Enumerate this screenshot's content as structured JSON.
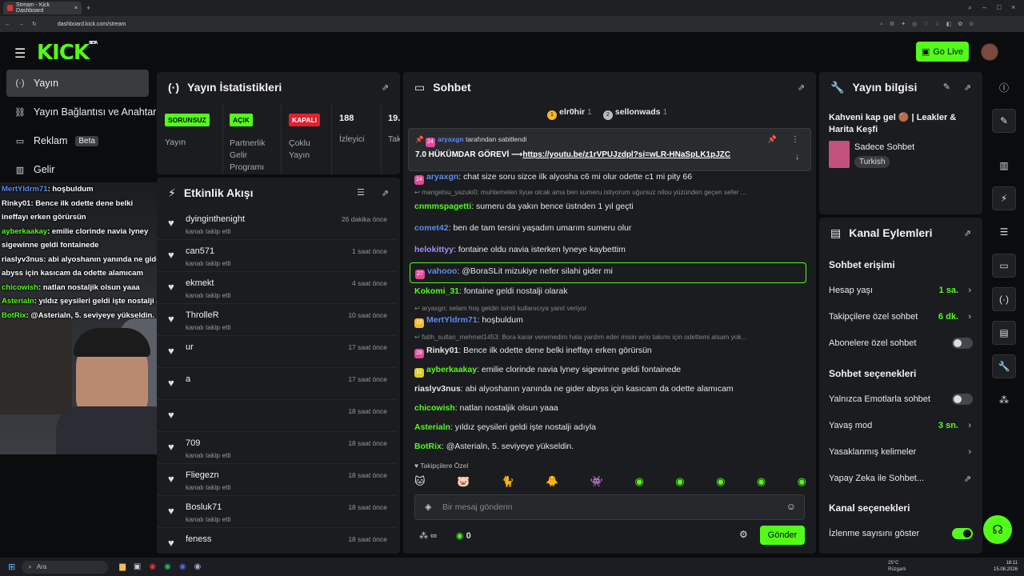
{
  "browser": {
    "tab_title": "Stream - Kick Dashboard",
    "url": "dashboard.kick.com/stream"
  },
  "header": {
    "logo": "KICK",
    "logo_badge": "BETA",
    "go_live": "Go Live"
  },
  "nav": [
    {
      "label": "Yayın",
      "icon": "(·)"
    },
    {
      "label": "Yayın Bağlantısı ve Anahtar",
      "icon": "⛓"
    },
    {
      "label": "Reklam",
      "icon": "▭",
      "badge": "Beta"
    },
    {
      "label": "Gelir",
      "icon": "▥"
    }
  ],
  "stats": {
    "title": "Yayın İstatistikleri",
    "items": [
      {
        "badge": "SORUNSUZ",
        "label": "Yayın",
        "color": "#53fc18"
      },
      {
        "badge": "AÇIK",
        "label": "Partnerlik Gelir Programı",
        "color": "#53fc18"
      },
      {
        "badge": "KAPALI",
        "label": "Çoklu Yayın",
        "color": "#e0222f"
      },
      {
        "value": "188",
        "label": "İzleyici"
      },
      {
        "value": "19.",
        "label": "Tak"
      }
    ]
  },
  "activity": {
    "title": "Etkinlik Akışı",
    "items": [
      {
        "name": "dyinginthenight",
        "sub": "kanalı takip etti",
        "time": "26 dakika önce"
      },
      {
        "name": "can571",
        "sub": "kanalı takip etti",
        "time": "1 saat önce"
      },
      {
        "name": "ekmekt",
        "sub": "kanalı takip etti",
        "time": "4 saat önce"
      },
      {
        "name": "ThrolleR",
        "sub": "kanalı takip etti",
        "time": "10 saat önce"
      },
      {
        "name": "ur",
        "sub": "",
        "time": "17 saat önce"
      },
      {
        "name": "a",
        "sub": "",
        "time": "17 saat önce"
      },
      {
        "name": "",
        "sub": "",
        "time": "18 saat önce"
      },
      {
        "name": "709",
        "sub": "kanalı takip etti",
        "time": "18 saat önce"
      },
      {
        "name": "Fliegezn",
        "sub": "kanalı takip etti",
        "time": "18 saat önce"
      },
      {
        "name": "Bosluk71",
        "sub": "kanalı takip etti",
        "time": "18 saat önce"
      },
      {
        "name": "feness",
        "sub": "",
        "time": "18 saat önce"
      }
    ]
  },
  "chat": {
    "title": "Sohbet",
    "top": [
      {
        "rank": "1",
        "name": "elr0hir",
        "count": "1"
      },
      {
        "rank": "2",
        "name": "sellonwads",
        "count": "1"
      }
    ],
    "pinned_by": "aryaxgn",
    "pinned_suffix": "tarafından sabitlendi",
    "pinned_text": "7.0 HÜKÜMDAR GÖREVİ ⟶",
    "pinned_link": "https://youtu.be/z1rVPUJzdpl?si=wLR-HNaSpLK1pJZC",
    "messages": [
      {
        "type": "msg",
        "badge": "24",
        "name": "aryaxgn",
        "color": "#5b8cf0",
        "text": "chat size soru sizce ilk alyosha c6 mi olur odette c1 mi pity 66"
      },
      {
        "type": "reply",
        "text": "mangetsu_yazuki0: muhtemelen liyue olcak ama ben sumeru istiyorum uğursuz nilou yüzünden geçen sefer ..."
      },
      {
        "type": "msg",
        "name": "cnmmspagetti",
        "color": "#53fc18",
        "text": "sumeru da yakın bence üstnden 1 yıl geçti"
      },
      {
        "type": "msg",
        "name": "comet42",
        "color": "#5b8cf0",
        "text": "ben de tam tersini yaşadım umarım sumeru olur"
      },
      {
        "type": "msg",
        "name": "helokittyy",
        "color": "#a78bfa",
        "text": "fontaine oldu navia isterken lyneye kaybettim"
      },
      {
        "type": "msg",
        "badge": "27",
        "name": "vahooo",
        "color": "#5b8cf0",
        "text": "@BoraSLit mizukiye nefer silahi gider mi"
      },
      {
        "type": "msg",
        "name": "Kokomi_31",
        "color": "#53fc18",
        "text": "fontaine geldi nostalji olarak"
      },
      {
        "type": "reply",
        "text": "aryaxgn: selam hoş geldin isimli kullanıcıya yanıt veriyor"
      },
      {
        "type": "msg",
        "badge": "18",
        "name": "MertYldrm71",
        "color": "#5b8cf0",
        "text": "hoşbuldum"
      },
      {
        "type": "reply",
        "text": "fatih_sultan_mehmet1453: Bora karar veremedim hala yardım eder misin wrio takımı için odettemi alsam yok..."
      },
      {
        "type": "msg",
        "badge": "28",
        "name": "Rinky01",
        "color": "#e8e8e8",
        "text": "Bence ilk odette dene belki ineffayı erken görürsün"
      },
      {
        "type": "msg",
        "badge": "11",
        "name": "ayberkaakay",
        "color": "#53fc18",
        "text": "emilie clorinde navia lyney sigewinne geldi fontainede"
      },
      {
        "type": "msg",
        "name": "riaslyv3nus",
        "color": "#e8e8e8",
        "text": "abi alyoshanın yanında ne gider abyss için kasıcam da odette alamıcam"
      },
      {
        "type": "msg",
        "name": "chicowish",
        "color": "#53fc18",
        "text": "natlan nostaljik olsun yaaa"
      },
      {
        "type": "msg",
        "name": "Asterialn",
        "color": "#53fc18",
        "text": "yıldız şeysileri geldi işte nostalji adıyla"
      },
      {
        "type": "msg",
        "name": "BotRix",
        "color": "#53fc18",
        "text": "@Asterialn, 5. seviyeye yükseldin."
      }
    ],
    "followers_only": "Takipçilere Özel",
    "input_placeholder": "Bir mesaj gönderin",
    "viewers": "∞",
    "points": "0",
    "send": "Gönder"
  },
  "info": {
    "title": "Yayın bilgisi",
    "stream_title": "Kahveni kap gel 🟤 | Leakler & Harita Keşfi",
    "category": "Sadece Sohbet",
    "language": "Turkish"
  },
  "channel": {
    "title": "Kanal Eylemleri",
    "chat_access": "Sohbet erişimi",
    "account_age_label": "Hesap yaşı",
    "account_age": "1 sa.",
    "followers_label": "Takipçilere özel sohbet",
    "followers_val": "6 dk.",
    "subs_label": "Abonelere özel sohbet",
    "chat_options": "Sohbet seçenekleri",
    "emotes_label": "Yalnızca Emotlarla sohbet",
    "slow_label": "Yavaş mod",
    "slow_val": "3 sn.",
    "banned_label": "Yasaklanmış kelimeler",
    "ai_label": "Yapay Zeka ile Sohbet...",
    "channel_options": "Kanal seçenekleri",
    "viewcount_label": "İzlenme sayısını göster"
  },
  "overlay": [
    {
      "name": "MertYldrm71",
      "text": ": hoşbuldum",
      "color": "#5b8cf0"
    },
    {
      "name": "Rinky01",
      "text": ": Bence ilk odette dene belki",
      "color": "#fff"
    },
    {
      "name": "",
      "text": "ineffayı erken görürsün",
      "color": "#fff"
    },
    {
      "name": "ayberkaakay",
      "text": ": emilie clorinde navia lyney",
      "color": "#53fc18"
    },
    {
      "name": "",
      "text": "sigewinne geldi fontainede",
      "color": "#fff"
    },
    {
      "name": "riaslyv3nus",
      "text": ": abi alyoshanın yanında ne gider",
      "color": "#fff"
    },
    {
      "name": "",
      "text": "abyss için kasıcam da odette alamıcam",
      "color": "#fff"
    },
    {
      "name": "chicowish",
      "text": ": natlan nostaljik olsun yaaa",
      "color": "#53fc18"
    },
    {
      "name": "Asterialn",
      "text": ": yıldız şeysileri geldi işte nostalji adıyla",
      "color": "#53fc18"
    },
    {
      "name": "BotRix",
      "text": ": @Asterialn, 5. seviyeye yükseldin.",
      "color": "#53fc18"
    }
  ],
  "taskbar": {
    "search": "Ara",
    "weather": "25°C",
    "weather_sub": "Rüzgarlı",
    "time": "18:11",
    "date": "15.08.2026"
  },
  "colors": {
    "accent": "#53fc18",
    "panel": "#1b1c1f",
    "bg": "#0b0c0e"
  }
}
